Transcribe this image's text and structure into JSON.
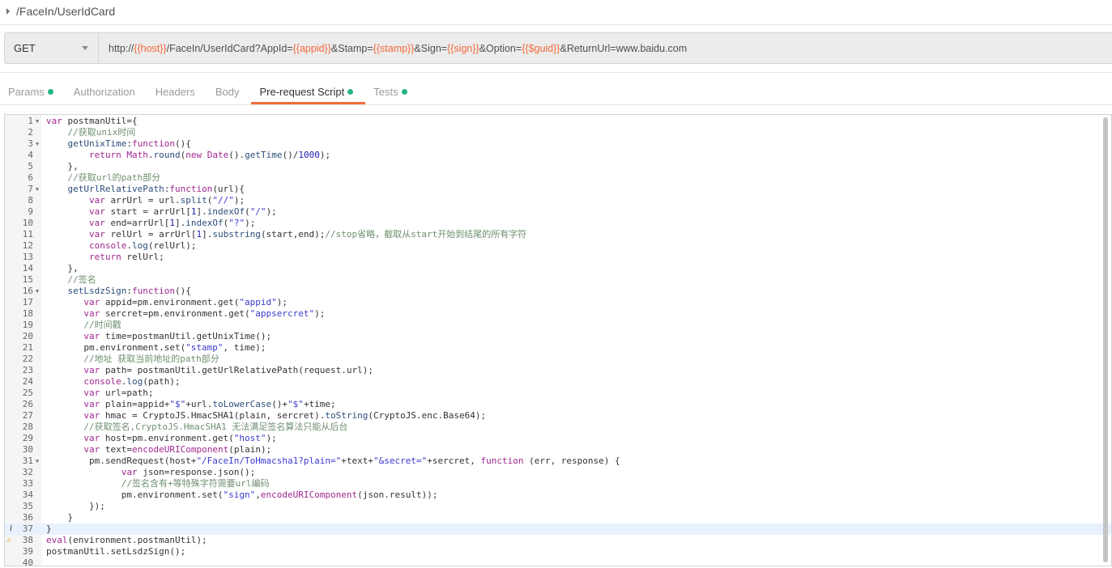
{
  "request": {
    "name": "/FaceIn/UserIdCard",
    "method": "GET",
    "url_parts": [
      [
        "t",
        "http://"
      ],
      [
        "v",
        "{{host}}"
      ],
      [
        "t",
        "/FaceIn/UserIdCard?AppId="
      ],
      [
        "v",
        "{{appid}}"
      ],
      [
        "t",
        "&Stamp="
      ],
      [
        "v",
        "{{stamp}}"
      ],
      [
        "t",
        "&Sign="
      ],
      [
        "v",
        "{{sign}}"
      ],
      [
        "t",
        "&Option="
      ],
      [
        "v",
        "{{$guid}}"
      ],
      [
        "t",
        "&ReturnUrl=www.baidu.com"
      ]
    ]
  },
  "tabs": [
    {
      "label": "Params",
      "dot": true
    },
    {
      "label": "Authorization",
      "dot": false
    },
    {
      "label": "Headers",
      "dot": false
    },
    {
      "label": "Body",
      "dot": false
    },
    {
      "label": "Pre-request Script",
      "dot": true,
      "active": true
    },
    {
      "label": "Tests",
      "dot": true
    }
  ],
  "colors": {
    "accent": "#f26b3a",
    "dot": "#26b47f",
    "variable": "#f26b3a"
  },
  "editor": {
    "highlighted_line": 37,
    "markers": {
      "37": "info-icon",
      "38": "warning-icon"
    },
    "foldable": [
      1,
      3,
      7,
      16,
      31
    ],
    "lines": [
      [
        [
          "k",
          "var"
        ],
        [
          "p",
          " postmanUtil={"
        ]
      ],
      [
        [
          "c",
          "    //获取unix时间"
        ]
      ],
      [
        [
          "m",
          "    getUnixTime"
        ],
        [
          "p",
          ":"
        ],
        [
          "k",
          "function"
        ],
        [
          "p",
          "(){"
        ]
      ],
      [
        [
          "k",
          "        return"
        ],
        [
          "p",
          " "
        ],
        [
          "k",
          "Math"
        ],
        [
          "p",
          "."
        ],
        [
          "m",
          "round"
        ],
        [
          "p",
          "("
        ],
        [
          "k",
          "new"
        ],
        [
          "p",
          " "
        ],
        [
          "k",
          "Date"
        ],
        [
          "p",
          "()."
        ],
        [
          "m",
          "getTime"
        ],
        [
          "p",
          "()/"
        ],
        [
          "n",
          "1000"
        ],
        [
          "p",
          ");"
        ]
      ],
      [
        [
          "p",
          "    },"
        ]
      ],
      [
        [
          "c",
          "    //获取url的path部分"
        ]
      ],
      [
        [
          "m",
          "    getUrlRelativePath"
        ],
        [
          "p",
          ":"
        ],
        [
          "k",
          "function"
        ],
        [
          "p",
          "(url){"
        ]
      ],
      [
        [
          "k",
          "        var"
        ],
        [
          "p",
          " arrUrl = url."
        ],
        [
          "m",
          "split"
        ],
        [
          "p",
          "("
        ],
        [
          "s",
          "\"//\""
        ],
        [
          "p",
          ");"
        ]
      ],
      [
        [
          "k",
          "        var"
        ],
        [
          "p",
          " start = arrUrl["
        ],
        [
          "n",
          "1"
        ],
        [
          "p",
          "]."
        ],
        [
          "m",
          "indexOf"
        ],
        [
          "p",
          "("
        ],
        [
          "s",
          "\"/\""
        ],
        [
          "p",
          ");"
        ]
      ],
      [
        [
          "k",
          "        var"
        ],
        [
          "p",
          " end=arrUrl["
        ],
        [
          "n",
          "1"
        ],
        [
          "p",
          "]."
        ],
        [
          "m",
          "indexOf"
        ],
        [
          "p",
          "("
        ],
        [
          "s",
          "\"?\""
        ],
        [
          "p",
          ");"
        ]
      ],
      [
        [
          "k",
          "        var"
        ],
        [
          "p",
          " relUrl = arrUrl["
        ],
        [
          "n",
          "1"
        ],
        [
          "p",
          "]."
        ],
        [
          "m",
          "substring"
        ],
        [
          "p",
          "(start,end);"
        ],
        [
          "c",
          "//stop省略，截取从start开始到结尾的所有字符"
        ]
      ],
      [
        [
          "k",
          "        console"
        ],
        [
          "p",
          "."
        ],
        [
          "m",
          "log"
        ],
        [
          "p",
          "(relUrl);"
        ]
      ],
      [
        [
          "k",
          "        return"
        ],
        [
          "p",
          " relUrl;"
        ]
      ],
      [
        [
          "p",
          "    },"
        ]
      ],
      [
        [
          "c",
          "    //签名"
        ]
      ],
      [
        [
          "m",
          "    setLsdzSign"
        ],
        [
          "p",
          ":"
        ],
        [
          "k",
          "function"
        ],
        [
          "p",
          "(){"
        ]
      ],
      [
        [
          "k",
          "       var"
        ],
        [
          "p",
          " appid=pm.environment.get("
        ],
        [
          "s",
          "\"appid\""
        ],
        [
          "p",
          ");"
        ]
      ],
      [
        [
          "k",
          "       var"
        ],
        [
          "p",
          " sercret=pm.environment.get("
        ],
        [
          "s",
          "\"appsercret\""
        ],
        [
          "p",
          ");"
        ]
      ],
      [
        [
          "c",
          "       //时间戳"
        ]
      ],
      [
        [
          "k",
          "       var"
        ],
        [
          "p",
          " time=postmanUtil.getUnixTime();"
        ]
      ],
      [
        [
          "p",
          "       pm.environment.set("
        ],
        [
          "s",
          "\"stamp\""
        ],
        [
          "p",
          ", time);"
        ]
      ],
      [
        [
          "c",
          "       //地址 获取当前地址的path部分"
        ]
      ],
      [
        [
          "k",
          "       var"
        ],
        [
          "p",
          " path= postmanUtil.getUrlRelativePath(request.url);"
        ]
      ],
      [
        [
          "k",
          "       console"
        ],
        [
          "p",
          "."
        ],
        [
          "m",
          "log"
        ],
        [
          "p",
          "(path);"
        ]
      ],
      [
        [
          "k",
          "       var"
        ],
        [
          "p",
          " url=path;"
        ]
      ],
      [
        [
          "k",
          "       var"
        ],
        [
          "p",
          " plain=appid+"
        ],
        [
          "s",
          "\"$\""
        ],
        [
          "p",
          "+url."
        ],
        [
          "m",
          "toLowerCase"
        ],
        [
          "p",
          "()+"
        ],
        [
          "s",
          "\"$\""
        ],
        [
          "p",
          "+time;"
        ]
      ],
      [
        [
          "k",
          "       var"
        ],
        [
          "p",
          " hmac = CryptoJS.HmacSHA1(plain, sercret)."
        ],
        [
          "m",
          "toString"
        ],
        [
          "p",
          "(CryptoJS.enc.Base64);"
        ]
      ],
      [
        [
          "c",
          "       //获取签名,CryptoJS.HmacSHA1 无法满足签名算法只能从后台"
        ]
      ],
      [
        [
          "k",
          "       var"
        ],
        [
          "p",
          " host=pm.environment.get("
        ],
        [
          "s",
          "\"host\""
        ],
        [
          "p",
          ");"
        ]
      ],
      [
        [
          "k",
          "       var"
        ],
        [
          "p",
          " text="
        ],
        [
          "k",
          "encodeURIComponent"
        ],
        [
          "p",
          "(plain);"
        ]
      ],
      [
        [
          "p",
          "        pm.sendRequest(host+"
        ],
        [
          "s",
          "\"/FaceIn/ToHmacsha1?plain=\""
        ],
        [
          "p",
          "+text+"
        ],
        [
          "s",
          "\"&secret=\""
        ],
        [
          "p",
          "+sercret, "
        ],
        [
          "k",
          "function"
        ],
        [
          "p",
          " (err, response) {"
        ]
      ],
      [
        [
          "k",
          "              var"
        ],
        [
          "p",
          " json=response.json();"
        ]
      ],
      [
        [
          "c",
          "              //签名含有+等特殊字符需要url编码"
        ]
      ],
      [
        [
          "p",
          "              pm.environment.set("
        ],
        [
          "s",
          "\"sign\""
        ],
        [
          "p",
          ","
        ],
        [
          "k",
          "encodeURIComponent"
        ],
        [
          "p",
          "(json.result));"
        ]
      ],
      [
        [
          "p",
          "        });"
        ]
      ],
      [
        [
          "p",
          "    }"
        ]
      ],
      [
        [
          "p",
          "}"
        ]
      ],
      [
        [
          "k",
          "eval"
        ],
        [
          "p",
          "(environment.postmanUtil);"
        ]
      ],
      [
        [
          "p",
          "postmanUtil.setLsdzSign();"
        ]
      ],
      [
        [
          "p",
          ""
        ]
      ]
    ]
  }
}
